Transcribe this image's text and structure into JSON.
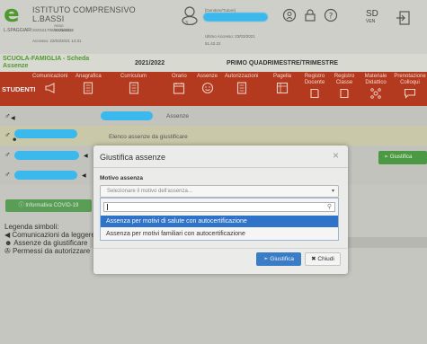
{
  "header": {
    "logo_letter": "e",
    "logo_sub": "L.SPAGGIARI",
    "school_name_1": "ISTITUTO COMPRENSIVO",
    "school_name_2": "L.BASSI",
    "school_year_1": "Anno",
    "school_year_2": "Scolastico",
    "school_code": "SS0161708/2021/2022",
    "login_info": "Accesso: 23/03/2021 14:31",
    "user_type": "[Genitore/Tutore]",
    "user_num": "3",
    "last_access": "Ultimo Accesso: 23/03/2021",
    "ip": "51.42.22",
    "lang_main": "SD",
    "lang_sub": "VEN"
  },
  "titlebar": {
    "section_line1": "SCUOLA-FAMIGLIA - Scheda",
    "section_line2": "Assenze",
    "year": "2021/2022",
    "period": "PRIMO QUADRIMESTRE/TRIMESTRE"
  },
  "menu": {
    "student": "STUDENTI",
    "items": [
      {
        "label": "Comunicazioni",
        "icon": "megaphone-icon"
      },
      {
        "label": "Anagrafica",
        "icon": "document-icon"
      },
      {
        "label": "Curriculum",
        "icon": "document-icon"
      },
      {
        "label": "Orario",
        "icon": "calendar-icon"
      },
      {
        "label": "Assenze",
        "icon": "smiley-icon"
      },
      {
        "label": "Autorizzazioni",
        "icon": "document-icon"
      },
      {
        "label": "Pagella",
        "icon": "report-card-icon"
      },
      {
        "label": "Registro Docente",
        "icon": "book-icon"
      },
      {
        "label": "Registro Classe",
        "icon": "book-icon"
      },
      {
        "label": "Materiale Didattico",
        "icon": "network-icon"
      },
      {
        "label": "Prenotazione Colloqui",
        "icon": "chat-icon"
      }
    ]
  },
  "content": {
    "row1_text": "Assenze",
    "row2_text": "Elenco assenze da giustificare",
    "giustifica_btn": "Giustifica",
    "covid_btn": "Informativa COVID-19",
    "legend_title": "Legenda simboli:",
    "legend_items": [
      "Comunicazioni da leggere",
      "Assenze da giustificare",
      "Permessi da autorizzare"
    ]
  },
  "modal": {
    "title": "Giustifica assenze",
    "field_label": "Motivo assenza",
    "select_placeholder": "Selezionare il motivo dell'assenza...",
    "options": [
      "Assenza per motivi di salute con autocertificazione",
      "Assenza per motivi familiari con autocertificazione"
    ],
    "ok_label": "Giustifica",
    "close_label": "Chiudi"
  },
  "colors": {
    "brand_green": "#4f9a2f",
    "menu_red": "#b33a1f",
    "redaction_blue": "#3bb8ec",
    "highlight_blue": "#2f73c8"
  }
}
